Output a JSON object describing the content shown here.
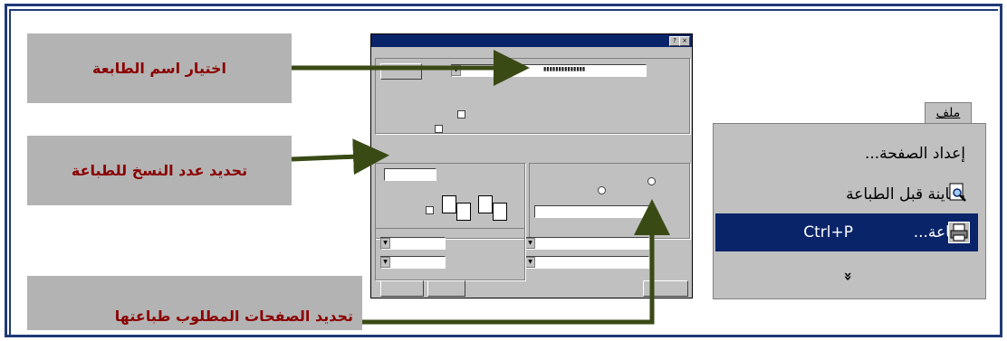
{
  "callouts": {
    "printer_name": "اختيار اسم الطابعة",
    "copies": "تحديد عدد النسخ للطباعة",
    "pages": "تحديد الصفحات المطلوب طباعتها"
  },
  "menu": {
    "header": "ملف",
    "items": [
      {
        "label": "إعداد الصفحة...",
        "icon": "page-setup-icon"
      },
      {
        "label": "معاينة قبل الطباعة",
        "icon": "print-preview-icon"
      },
      {
        "label": "طباعة...",
        "shortcut": "Ctrl+P",
        "icon": "printer-icon",
        "selected": true
      }
    ],
    "more": "»"
  },
  "colors": {
    "frame": "#1f3b78",
    "callout_bg": "#b3b3b3",
    "callout_text": "#8b0000",
    "arrow": "#3a4a14",
    "selection": "#0a246a"
  }
}
